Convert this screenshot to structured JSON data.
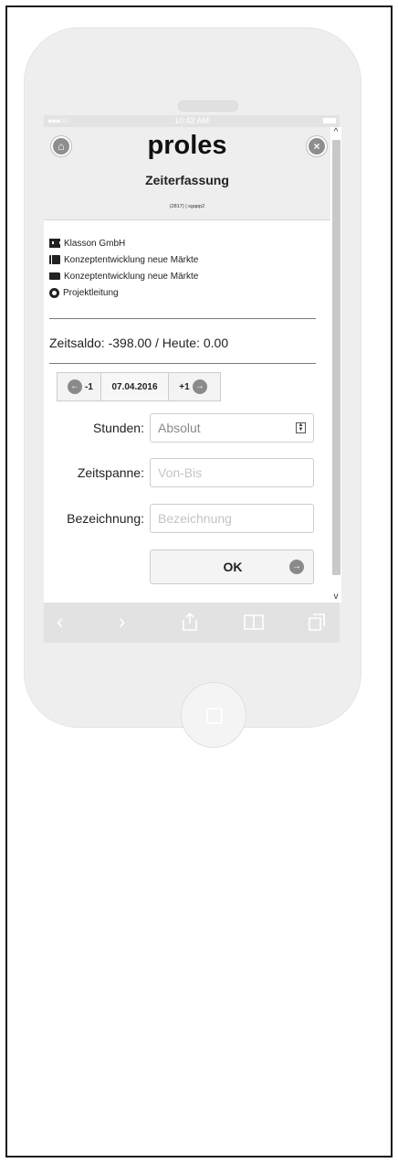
{
  "statusbar": {
    "carrier_dots": "●●●○○",
    "time": "10:42 AM"
  },
  "header": {
    "logo": "proles",
    "subtitle": "Zeiterfassung",
    "userline": "(2817) | sgapp2",
    "home_icon": "home-icon",
    "close_icon": "close-icon"
  },
  "info": {
    "company": "Klasson GmbH",
    "project": "Konzeptentwicklung neue Märkte",
    "subproject": "Konzeptentwicklung neue Märkte",
    "role": "Projektleitung"
  },
  "saldo": "Zeitsaldo: -398.00 / Heute: 0.00",
  "datebar": {
    "prev_label": "-1",
    "date": "07.04.2016",
    "next_label": "+1"
  },
  "form": {
    "hours_label": "Stunden:",
    "hours_value": "Absolut",
    "timespan_label": "Zeitspanne:",
    "timespan_placeholder": "Von-Bis",
    "desc_label": "Bezeichnung:",
    "desc_placeholder": "Bezeichnung",
    "ok_label": "OK"
  },
  "scroll": {
    "up": "^",
    "down": "v"
  },
  "browser": {
    "back": "‹",
    "forward": "›"
  }
}
